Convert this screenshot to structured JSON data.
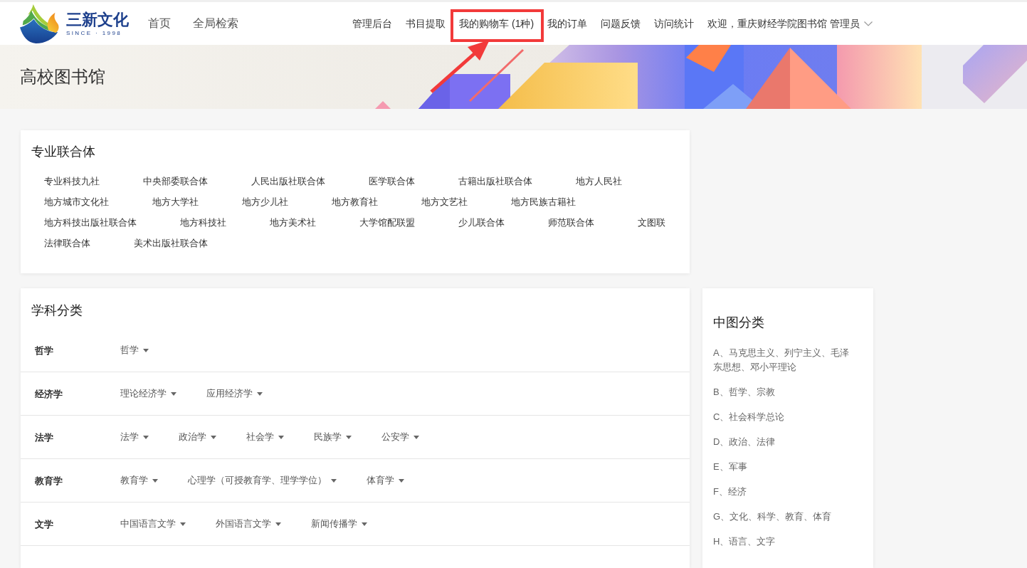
{
  "header": {
    "logo": {
      "name": "三新文化",
      "tagline": "SINCE · 1998"
    },
    "main_nav": [
      {
        "label": "首页"
      },
      {
        "label": "全局检索"
      }
    ],
    "top_links": [
      {
        "label": "管理后台",
        "highlighted": false
      },
      {
        "label": "书目提取",
        "highlighted": false
      },
      {
        "label": "我的购物车 (1种)",
        "highlighted": true
      },
      {
        "label": "我的订单",
        "highlighted": false
      },
      {
        "label": "问题反馈",
        "highlighted": false
      },
      {
        "label": "访问统计",
        "highlighted": false
      }
    ],
    "user_menu": {
      "label": "欢迎，重庆财经学院图书馆 管理员"
    }
  },
  "banner": {
    "title": "高校图书馆"
  },
  "publisher_groups": {
    "title": "专业联合体",
    "items": [
      "专业科技九社",
      "中央部委联合体",
      "人民出版社联合体",
      "医学联合体",
      "古籍出版社联合体",
      "地方人民社",
      "地方城市文化社",
      "地方大学社",
      "地方少儿社",
      "地方教育社",
      "地方文艺社",
      "地方民族古籍社",
      "地方科技出版社联合体",
      "地方科技社",
      "地方美术社",
      "大学馆配联盟",
      "少儿联合体",
      "师范联合体",
      "文图联",
      "法律联合体",
      "美术出版社联合体"
    ]
  },
  "subjects": {
    "title": "学科分类",
    "rows": [
      {
        "name": "哲学",
        "items": [
          "哲学"
        ]
      },
      {
        "name": "经济学",
        "items": [
          "理论经济学",
          "应用经济学"
        ]
      },
      {
        "name": "法学",
        "items": [
          "法学",
          "政治学",
          "社会学",
          "民族学",
          "公安学"
        ]
      },
      {
        "name": "教育学",
        "items": [
          "教育学",
          "心理学（可授教育学、理学学位）",
          "体育学"
        ]
      },
      {
        "name": "文学",
        "items": [
          "中国语言文学",
          "外国语言文学",
          "新闻传播学"
        ]
      }
    ]
  },
  "classification": {
    "title": "中图分类",
    "items": [
      "A、马克思主义、列宁主义、毛泽东思想、邓小平理论",
      "B、哲学、宗教",
      "C、社会科学总论",
      "D、政治、法律",
      "E、军事",
      "F、经济",
      "G、文化、科学、教育、体育",
      "H、语言、文字"
    ]
  }
}
